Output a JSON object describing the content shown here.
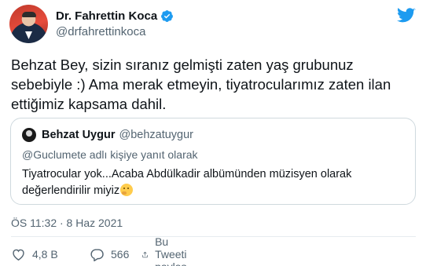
{
  "author": {
    "display_name": "Dr. Fahrettin Koca",
    "handle": "@drfahrettinkoca",
    "verified": true
  },
  "tweet": {
    "text": "Behzat Bey, sizin sıranız gelmişti zaten yaş grubunuz sebebiyle :) Ama merak etmeyin, tiyatrocularımız zaten ilan ettiğimiz kapsama dahil.",
    "timestamp": "ÖS 11:32 · 8 Haz 2021"
  },
  "quoted": {
    "display_name": "Behzat Uygur",
    "handle": "@behzatuygur",
    "reply_context": "@Guclumete adlı kişiye yanıt olarak",
    "text": "Tiyatrocular yok...Acaba Abdülkadir albümünden müzisyen olarak değerlendirilir miyiz"
  },
  "actions": {
    "likes": "4,8 B",
    "replies": "566",
    "share_label": "Bu Tweeti paylaş"
  },
  "icons": {
    "verified": "verified-badge-icon",
    "brand": "twitter-bird-icon",
    "like": "heart-icon",
    "reply": "reply-bubble-icon",
    "share": "share-icon",
    "emoji": "thinking-face-emoji"
  },
  "colors": {
    "brand_blue": "#1d9bf0",
    "text_primary": "#0f1419",
    "text_secondary": "#536471",
    "border": "#cfd9de"
  }
}
